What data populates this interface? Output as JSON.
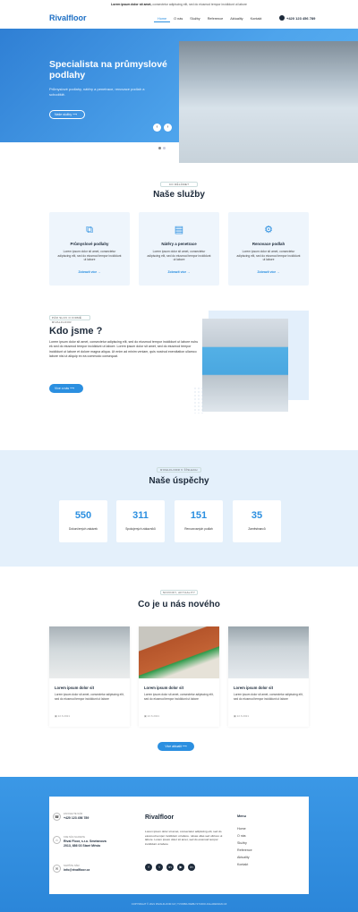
{
  "topbar": {
    "bold": "Lorem ipsum dolor sit amet,",
    "rest": " consectetur adipiscing elit, sed do eiusmod tempor incididunt ut labore"
  },
  "nav": {
    "logo": "Rivalfloor",
    "items": [
      "Home",
      "O nás",
      "Služby",
      "Reference",
      "Aktuality",
      "Kontakt"
    ],
    "phone": "+420 123 456 789"
  },
  "hero": {
    "title": "Specialista na průmyslové podlahy",
    "subtitle": "Průmyslové podlahy, nátěry a penetrace, renovace podlah a schodiště.",
    "button": "Naše služby",
    "prev": "‹",
    "next": "›"
  },
  "services": {
    "tag": "CO DĚLÁME?",
    "title": "Naše služby",
    "items": [
      {
        "title": "Průmyslové podlahy",
        "text": "Lorem ipsum dolor sit amet, consectetur adipiscing elit, sed do eiusmod tempor incididunt ut labore",
        "link": "Zobrazit více →",
        "icon": "layers-icon"
      },
      {
        "title": "Nátěry a penetrace",
        "text": "Lorem ipsum dolor sit amet, consectetur adipiscing elit, sed do eiusmod tempor incididunt ut labore",
        "link": "Zobrazit více →",
        "icon": "paint-roller-icon"
      },
      {
        "title": "Renovace podlah",
        "text": "Lorem ipsum dolor sit amet, consectetur adipiscing elit, sed do eiusmod tempor incididunt ut labore",
        "link": "Zobrazit více →",
        "icon": "gear-icon"
      }
    ]
  },
  "about": {
    "tag": "PÁR SLOV O FIRMĚ RIVALFLOOR",
    "title": "Kdo jsme ?",
    "text": "Lorem ipsum dolor sit amet, consectetur adipiscing elit, sed do eiusmod tempor incididunt ut labore nuhu ek sed do eiusmod tempor incididunt ut labore. Lorem ipsum dolor sit amet, sed do eiusmod tempor incididunt ut labore et dolore magna aliqua. Ut enim ad minim veniam, quis nostrud exercitation ullamco labore nisi ut aliquip ex ea commodo consequat.",
    "button": "Více o nás"
  },
  "stats": {
    "tag": "RIVALFLOOR V ČÍSLECH",
    "title": "Naše úspěchy",
    "items": [
      {
        "value": "550",
        "label": "Dokončených zakázek"
      },
      {
        "value": "311",
        "label": "Spokojených zákazníků"
      },
      {
        "value": "151",
        "label": "Renovovaných podlah"
      },
      {
        "value": "35",
        "label": "Zaměstnanců"
      }
    ]
  },
  "news": {
    "tag": "NOVINKY, AKTUALITY",
    "title": "Co je u nás nového",
    "items": [
      {
        "title": "Lorem ipsum dolor sit",
        "text": "Lorem ipsum dolor sit amet, consectetur adipiscing elit, sed do eiusmod tempor incididunt ut labore",
        "date": "22.6.2021"
      },
      {
        "title": "Lorem ipsum dolor sit",
        "text": "Lorem ipsum dolor sit amet, consectetur adipiscing elit, sed do eiusmod tempor incididunt ut labore",
        "date": "22.6.2021"
      },
      {
        "title": "Lorem ipsum dolor sit",
        "text": "Lorem ipsum dolor sit amet, consectetur adipiscing elit, sed do eiusmod tempor incididunt ut labore",
        "date": "22.6.2021"
      }
    ],
    "button": "Více aktualit"
  },
  "footer": {
    "contacts": [
      {
        "label": "ZAVOLEJTE NÁM",
        "value": "+420 123 456 789",
        "icon": "phone-icon"
      },
      {
        "label": "KDE NÁS NAJDETE",
        "value": "Rival Floor, s.r.o. Smetanova 2013, 686 03 Staré Město",
        "icon": "location-icon"
      },
      {
        "label": "NAPIŠTE NÁM",
        "value": "info@rivalfloor.cz",
        "icon": "mail-icon"
      }
    ],
    "logo": "Rivalfloor",
    "text": "Lorem ipsum dolor sit amet, consectetur adipiscing elit, sed do eiusmod tempor incididunt ut labore. nduas ullas sed ultrices ut labore. Lorem ipsum dolor sit amet, sed do eiusmod tempor incididunt ut labore",
    "social": [
      "f",
      "t",
      "in",
      "▶",
      "in"
    ],
    "menu_title": "Menu",
    "menu": [
      "Home",
      "O nás",
      "Služby",
      "Reference",
      "Aktuality",
      "Kontakt"
    ],
    "copyright": "COPYRIGHT © 2021 RIVALFLOOR.CZ | TVORBA WEBU STUDIO-KALADESIGN.CZ"
  },
  "colors": {
    "accent": "#2b8fe0",
    "dark": "#1d2a3a",
    "light_bg": "#e4f0fb"
  }
}
